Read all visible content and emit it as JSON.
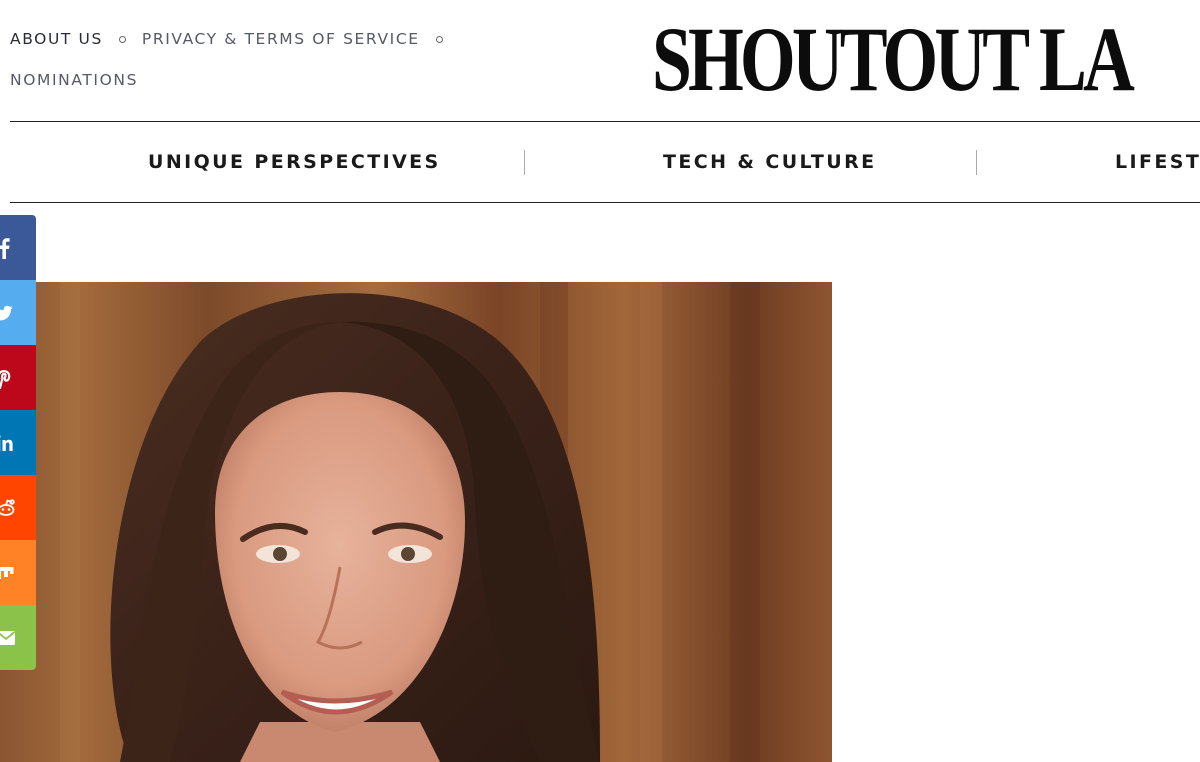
{
  "top_links": {
    "about": "ABOUT US",
    "privacy": "PRIVACY & TERMS OF SERVICE",
    "nominations": "NOMINATIONS"
  },
  "logo": {
    "text": "SHOUTOUT LA"
  },
  "nav": {
    "items": [
      {
        "label": "UNIQUE PERSPECTIVES"
      },
      {
        "label": "TECH & CULTURE"
      },
      {
        "label": "LIFESTYLE"
      }
    ]
  },
  "social": {
    "buttons": [
      {
        "icon": "facebook-icon",
        "color": "#3b5998"
      },
      {
        "icon": "twitter-icon",
        "color": "#55acee"
      },
      {
        "icon": "pinterest-icon",
        "color": "#bd081c"
      },
      {
        "icon": "linkedin-icon",
        "color": "#0077b5"
      },
      {
        "icon": "reddit-icon",
        "color": "#ff4500"
      },
      {
        "icon": "mix-icon",
        "color": "#ff8226"
      },
      {
        "icon": "email-icon",
        "color": "#8bc34a"
      }
    ]
  },
  "colors": {
    "nav_line": "#222222",
    "top_link_text": "#555a66",
    "logo_text": "#0c0c0c"
  }
}
